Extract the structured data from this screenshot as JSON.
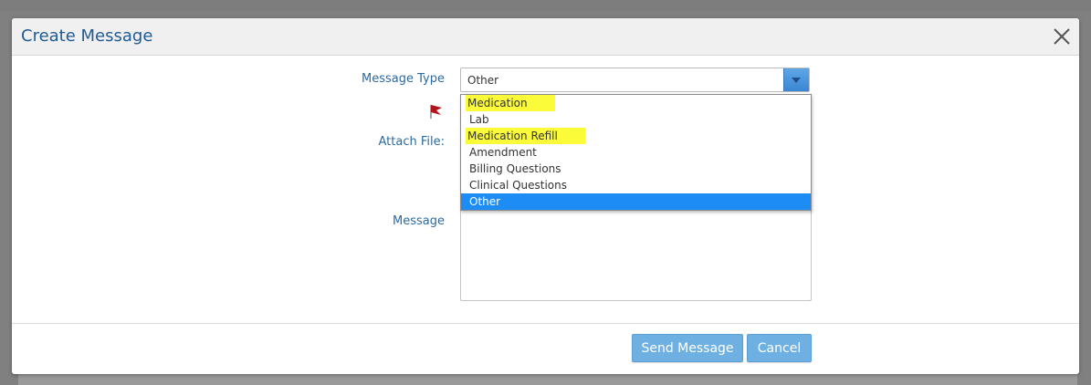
{
  "modal": {
    "title": "Create Message",
    "close_icon": "close-icon"
  },
  "form": {
    "message_type_label": "Message Type",
    "attach_file_label": "Attach File:",
    "message_label": "Message",
    "flag_icon": "flag-icon"
  },
  "message_type": {
    "selected_value": "Other",
    "options": [
      {
        "label": "Medication",
        "highlighted": true
      },
      {
        "label": "Lab",
        "highlighted": false
      },
      {
        "label": "Medication Refill",
        "highlighted": true
      },
      {
        "label": "Amendment",
        "highlighted": false
      },
      {
        "label": "Billing Questions",
        "highlighted": false
      },
      {
        "label": "Clinical Questions",
        "highlighted": false
      },
      {
        "label": "Other",
        "selected": true
      }
    ]
  },
  "footer": {
    "send_label": "Send Message",
    "cancel_label": "Cancel"
  },
  "colors": {
    "accent": "#1e8cf5",
    "title": "#1f5b93",
    "highlight": "#fbfb3a",
    "button": "#6fb0e3"
  }
}
